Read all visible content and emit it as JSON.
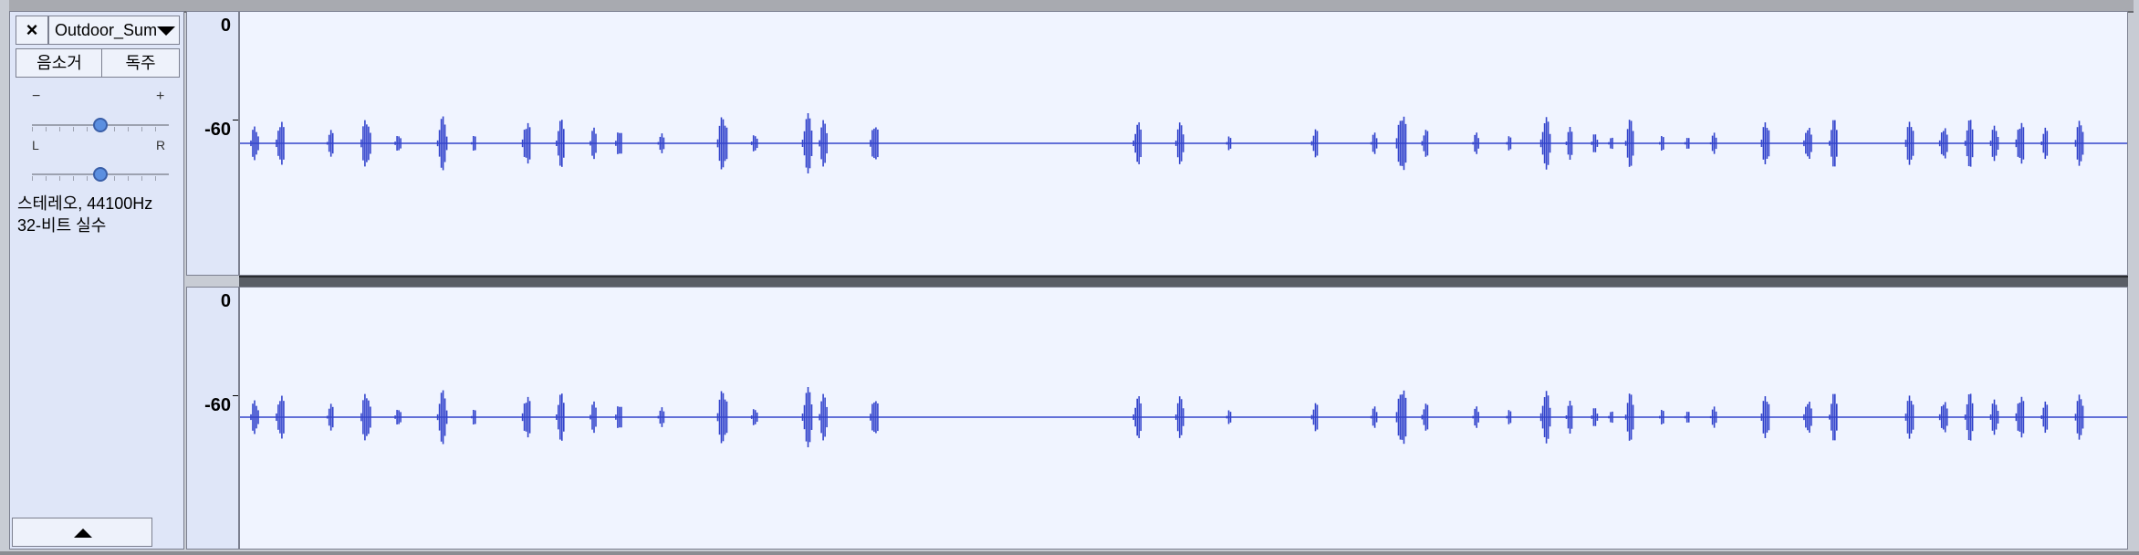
{
  "track": {
    "close_label": "×",
    "name": "Outdoor_Sum",
    "mute_label": "음소거",
    "solo_label": "독주",
    "gain_minus": "−",
    "gain_plus": "+",
    "pan_left": "L",
    "pan_right": "R",
    "gain_level": 0.5,
    "pan_level": 0.5,
    "info_line1": "스테레오, 44100Hz",
    "info_line2": "32-비트 실수"
  },
  "rulers": [
    {
      "top_label": "0",
      "mid_label": "-60"
    },
    {
      "top_label": "0",
      "mid_label": "-60"
    }
  ],
  "waveform": {
    "color": "#3344cc",
    "background": "#f0f4ff",
    "bursts": [
      [
        0.0,
        0.35
      ],
      [
        0.015,
        0.45
      ],
      [
        0.045,
        0.25
      ],
      [
        0.065,
        0.5
      ],
      [
        0.085,
        0.2
      ],
      [
        0.11,
        0.5
      ],
      [
        0.13,
        0.15
      ],
      [
        0.16,
        0.45
      ],
      [
        0.18,
        0.45
      ],
      [
        0.2,
        0.3
      ],
      [
        0.215,
        0.3
      ],
      [
        0.24,
        0.2
      ],
      [
        0.275,
        0.55
      ],
      [
        0.295,
        0.2
      ],
      [
        0.325,
        0.55
      ],
      [
        0.335,
        0.45
      ],
      [
        0.365,
        0.4
      ],
      [
        0.52,
        0.4
      ],
      [
        0.545,
        0.4
      ],
      [
        0.575,
        0.15
      ],
      [
        0.625,
        0.3
      ],
      [
        0.66,
        0.2
      ],
      [
        0.675,
        0.6
      ],
      [
        0.69,
        0.3
      ],
      [
        0.72,
        0.2
      ],
      [
        0.74,
        0.15
      ],
      [
        0.76,
        0.5
      ],
      [
        0.775,
        0.3
      ],
      [
        0.79,
        0.2
      ],
      [
        0.8,
        0.15
      ],
      [
        0.81,
        0.45
      ],
      [
        0.83,
        0.15
      ],
      [
        0.845,
        0.15
      ],
      [
        0.86,
        0.2
      ],
      [
        0.89,
        0.45
      ],
      [
        0.915,
        0.35
      ],
      [
        0.93,
        0.45
      ],
      [
        0.975,
        0.45
      ],
      [
        0.995,
        0.35
      ],
      [
        1.01,
        0.45
      ],
      [
        1.025,
        0.35
      ],
      [
        1.04,
        0.45
      ],
      [
        1.055,
        0.3
      ],
      [
        1.075,
        0.45
      ]
    ]
  }
}
